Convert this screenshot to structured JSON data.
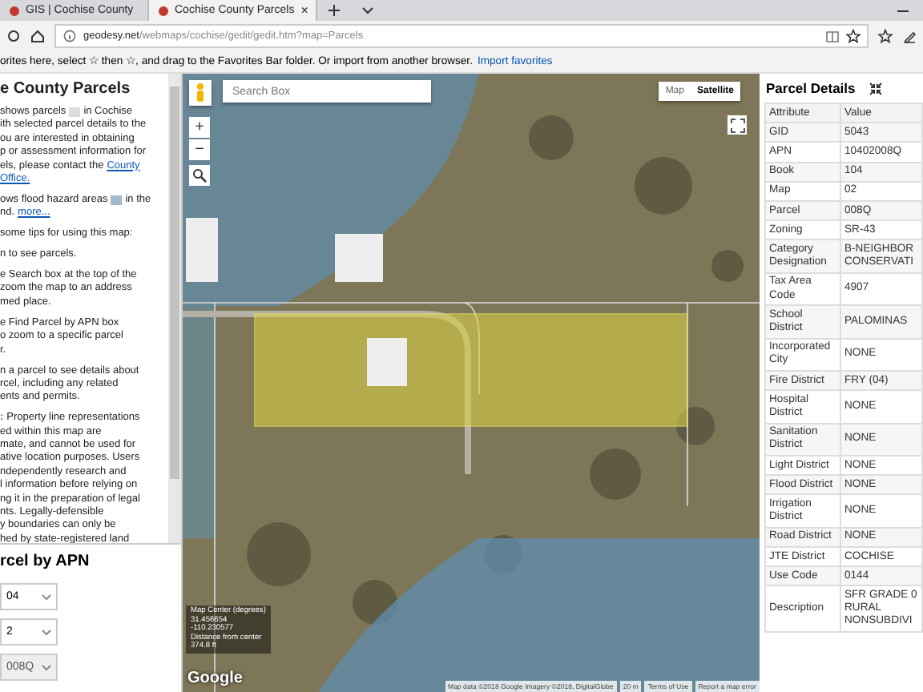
{
  "browser": {
    "tab_close": "×",
    "tabs": [
      {
        "label": "GIS | Cochise County",
        "selected": false
      },
      {
        "label": "Cochise County Parcels",
        "selected": true
      }
    ],
    "address": {
      "host": "geodesy.net",
      "path": "/webmaps/cochise/gedit/gedit.htm?map=Parcels"
    },
    "favorites_prompt": {
      "text": "orites here, select ☆ then ☆, and drag to the Favorites Bar folder. Or import from another browser.",
      "link": "Import favorites"
    }
  },
  "sidebar": {
    "title": "e County Parcels",
    "paragraphs": [
      [
        [
          {
            "kind": "text",
            "text": "shows parcels"
          },
          {
            "kind": "swatch",
            "color": "#dcdcdc"
          },
          {
            "kind": "text",
            "text": "in Cochise"
          }
        ],
        [
          {
            "kind": "text",
            "text": "ith selected parcel details to the"
          }
        ],
        [
          {
            "kind": "text",
            "text": "ou are interested in obtaining"
          }
        ],
        [
          {
            "kind": "text",
            "text": "p or assessment information for"
          }
        ],
        [
          {
            "kind": "text",
            "text": "els, please contact the"
          },
          {
            "kind": "link",
            "text": "County"
          }
        ],
        [
          {
            "kind": "link",
            "text": "Office."
          }
        ]
      ],
      [
        [
          {
            "kind": "text",
            "text": "ows flood hazard areas"
          },
          {
            "kind": "swatch",
            "color": "#9fb9cf"
          },
          {
            "kind": "text",
            "text": "in the"
          }
        ],
        [
          {
            "kind": "text",
            "text": "nd."
          },
          {
            "kind": "link",
            "text": "more..."
          }
        ]
      ],
      [
        [
          {
            "kind": "text",
            "text": "some tips for using this map:"
          }
        ]
      ],
      [
        [
          {
            "kind": "text",
            "text": "n to see parcels."
          }
        ]
      ],
      [
        [
          {
            "kind": "text",
            "text": "e Search box at the top of the"
          }
        ],
        [
          {
            "kind": "text",
            "text": "zoom the map to an address"
          }
        ],
        [
          {
            "kind": "text",
            "text": "med place."
          }
        ]
      ],
      [
        [
          {
            "kind": "text",
            "text": "e Find Parcel by APN box"
          }
        ],
        [
          {
            "kind": "text",
            "text": "o zoom to a specific parcel"
          }
        ],
        [
          {
            "kind": "text",
            "text": "r."
          }
        ]
      ],
      [
        [
          {
            "kind": "text",
            "text": "n a parcel to see details about"
          }
        ],
        [
          {
            "kind": "text",
            "text": "rcel, including any related"
          }
        ],
        [
          {
            "kind": "text",
            "text": "ents and permits."
          }
        ]
      ],
      [
        [
          {
            "kind": "warning",
            "text": ":"
          },
          {
            "kind": "text",
            "text": "Property line representations"
          }
        ],
        [
          {
            "kind": "text",
            "text": "ed within this map are"
          }
        ],
        [
          {
            "kind": "text",
            "text": "mate, and cannot be used for"
          }
        ],
        [
          {
            "kind": "text",
            "text": "ative location purposes. Users"
          }
        ],
        [
          {
            "kind": "text",
            "text": "ndependently research and"
          }
        ],
        [
          {
            "kind": "text",
            "text": "l information before relying on"
          }
        ],
        [
          {
            "kind": "text",
            "text": "ng it in the preparation of legal"
          }
        ],
        [
          {
            "kind": "text",
            "text": "nts. Legally-defensible"
          }
        ],
        [
          {
            "kind": "text",
            "text": "y boundaries can only be"
          }
        ],
        [
          {
            "kind": "text",
            "text": "hed by state-registered land"
          }
        ]
      ]
    ],
    "apn": {
      "title": "rcel by APN",
      "selects": [
        {
          "value": "04",
          "disabled": false
        },
        {
          "value": "2",
          "disabled": false
        },
        {
          "value": "008Q",
          "disabled": true
        }
      ]
    }
  },
  "map": {
    "search": {
      "placeholder": "Search Box"
    },
    "map_types": [
      {
        "label": "Map",
        "selected": false
      },
      {
        "label": "Satellite",
        "selected": true
      }
    ],
    "zoom": [
      "+",
      "−"
    ],
    "center_info": [
      "Map Center (degrees)",
      "31.456654",
      "-110.230577",
      "Distance from center",
      "374.8 ft"
    ],
    "logo": "Google",
    "attribution": [
      "Map data ©2018 Google Imagery ©2018, DigitalGlobe",
      "20 m",
      "Terms of Use",
      "Report a map error"
    ]
  },
  "details": {
    "title": "Parcel Details",
    "columns": [
      "Attribute",
      "Value"
    ],
    "rows": [
      [
        "GID",
        "5043"
      ],
      [
        "APN",
        "10402008Q"
      ],
      [
        "Book",
        "104"
      ],
      [
        "Map",
        "02"
      ],
      [
        "Parcel",
        "008Q"
      ],
      [
        "Zoning",
        "SR-43"
      ],
      [
        "Category Designation",
        "B-NEIGHBOR\nCONSERVATI"
      ],
      [
        "Tax Area Code",
        "4907"
      ],
      [
        "School District",
        "PALOMINAS"
      ],
      [
        "Incorporated City",
        "NONE"
      ],
      [
        "Fire District",
        "FRY (04)"
      ],
      [
        "Hospital District",
        "NONE"
      ],
      [
        "Sanitation District",
        "NONE"
      ],
      [
        "Light District",
        "NONE"
      ],
      [
        "Flood District",
        "NONE"
      ],
      [
        "Irrigation District",
        "NONE"
      ],
      [
        "Road District",
        "NONE"
      ],
      [
        "JTE District",
        "COCHISE"
      ],
      [
        "Use Code",
        "0144"
      ],
      [
        "Description",
        "SFR GRADE 0\nRURAL\nNONSUBDIVI"
      ]
    ]
  }
}
